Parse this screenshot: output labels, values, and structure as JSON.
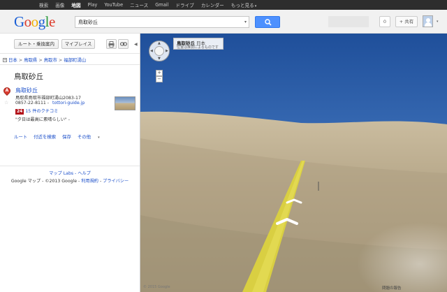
{
  "topbar": {
    "items": [
      {
        "label": "検索",
        "active": false
      },
      {
        "label": "画像",
        "active": false
      },
      {
        "label": "地図",
        "active": true
      },
      {
        "label": "Play",
        "active": false
      },
      {
        "label": "YouTube",
        "active": false
      },
      {
        "label": "ニュース",
        "active": false
      },
      {
        "label": "Gmail",
        "active": false
      },
      {
        "label": "ドライブ",
        "active": false
      },
      {
        "label": "カレンダー",
        "active": false
      },
      {
        "label": "もっと見る",
        "active": false
      }
    ]
  },
  "header": {
    "logo_text": "Google",
    "search_value": "鳥取砂丘",
    "count": "0",
    "share_label": "+ 共有"
  },
  "toolbar": {
    "route_label": "ルート・乗換案内",
    "myplaces_label": "マイプレイス",
    "print_icon": "printer-icon",
    "link_icon": "link-icon"
  },
  "breadcrumb": [
    "日本",
    "鳥取県",
    "鳥取市",
    "福部町湯山"
  ],
  "place": {
    "title": "鳥取砂丘",
    "name": "鳥取砂丘",
    "address": "鳥取県鳥取市福部町湯山2083-17",
    "phone": "0857-22-8111",
    "url": "tottori-guide.jp",
    "review_score": "24",
    "review_link": "15 件のクチコミ",
    "quote": "\"夕日は最高に素晴らしい\" -",
    "marker_letter": "A"
  },
  "actions": [
    "ルート",
    "付近を検索",
    "保存",
    "その他"
  ],
  "footer": {
    "labs": "マップ Labs",
    "separator": " - ",
    "help": "ヘルプ",
    "google_maps": "Google マップ - ©2013 Google - ",
    "terms": "利用規約",
    "privacy": "プライバシー"
  },
  "streetview": {
    "place_name": "鳥取砂丘",
    "country": "日本",
    "subtitle": "位置は推測によるものです",
    "copyright": "© 2015 Google",
    "report": "問題の報告"
  },
  "colors": {
    "link": "#1a4ec9",
    "search_button": "#4d90fe",
    "marker": "#d93a2f",
    "sand": "#b8a88a",
    "sky": "#2f5fa8"
  }
}
